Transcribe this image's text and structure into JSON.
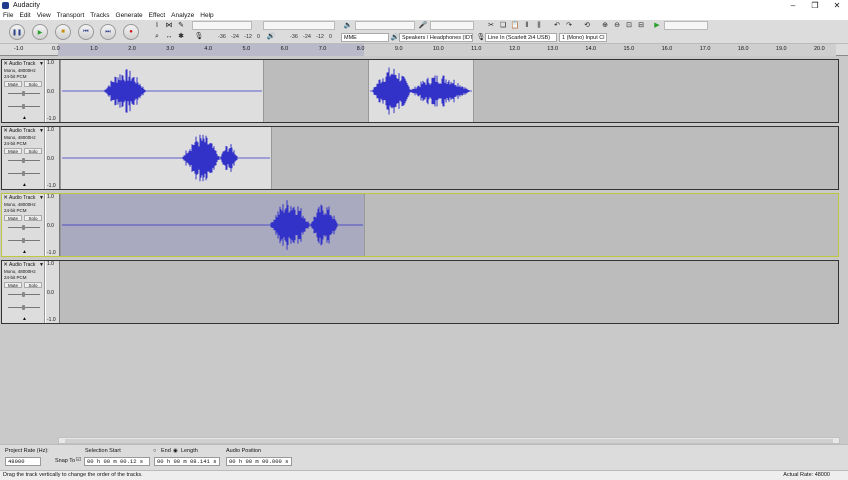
{
  "window": {
    "title": "Audacity"
  },
  "menu": [
    "File",
    "Edit",
    "View",
    "Transport",
    "Tracks",
    "Generate",
    "Effect",
    "Analyze",
    "Help"
  ],
  "meters": {
    "record_scale": [
      "-36",
      "-24",
      "-12",
      "0"
    ],
    "play_scale": [
      "-36",
      "-24",
      "-12",
      "0"
    ]
  },
  "devices": {
    "host": "MME",
    "output": "Speakers / Headphones (IDT H",
    "input": "Line In (Scarlett 2i4 USB)",
    "channels": "1 (Mono) Input Cl"
  },
  "ruler_ticks": [
    "-1.0",
    "0.0",
    "1.0",
    "2.0",
    "3.0",
    "4.0",
    "5.0",
    "6.0",
    "7.0",
    "8.0",
    "9.0",
    "10.0",
    "11.0",
    "12.0",
    "13.0",
    "14.0",
    "15.0",
    "16.0",
    "17.0",
    "18.0",
    "19.0",
    "20.0"
  ],
  "tracks": [
    {
      "name": "Audio Track",
      "info1": "Mono, 48000Hz",
      "info2": "24-bit PCM",
      "mute": "Mute",
      "solo": "Solo",
      "scale": [
        "1.0",
        "0.0",
        "-1.0"
      ]
    },
    {
      "name": "Audio Track",
      "info1": "Mono, 48000Hz",
      "info2": "24-bit PCM",
      "mute": "Mute",
      "solo": "Solo",
      "scale": [
        "1.0",
        "0.0",
        "-1.0"
      ]
    },
    {
      "name": "Audio Track",
      "info1": "Mono, 48000Hz",
      "info2": "24-bit PCM",
      "mute": "Mute",
      "solo": "Solo",
      "scale": [
        "1.0",
        "0.0",
        "-1.0"
      ]
    },
    {
      "name": "Audio Track",
      "info1": "Mono, 48000Hz",
      "info2": "24-bit PCM",
      "mute": "Mute",
      "solo": "Solo",
      "scale": [
        "1.0",
        "0.0",
        "-1.0"
      ]
    }
  ],
  "selection_toolbar": {
    "project_rate_label": "Project Rate (Hz):",
    "project_rate": "48000",
    "snap_to_label": "Snap To",
    "selection_start_label": "Selection Start",
    "end_label": "End",
    "length_label": "Length",
    "audio_position_label": "Audio Position",
    "selection_start": "00 h 00 m 00.12 s",
    "length": "00 h 00 m 08.141 s",
    "audio_position": "00 h 00 m 00.000 s"
  },
  "status": {
    "message": "Drag the track vertically to change the order of the tracks.",
    "actual_rate": "Actual Rate: 48000"
  },
  "colors": {
    "waveform": "#3232c8",
    "selected_border": "#bdc83d"
  }
}
